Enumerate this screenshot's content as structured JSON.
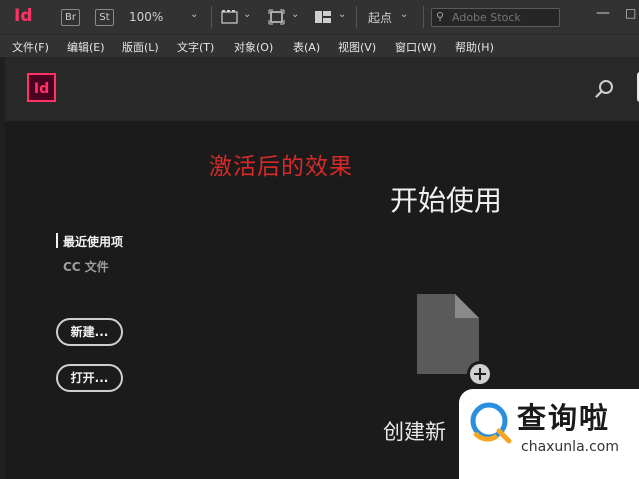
{
  "app": {
    "logo": "Id",
    "bridge_label": "Br",
    "stock_label": "St",
    "zoom": "100%",
    "workspace": "起点",
    "search_placeholder": "Adobe Stock"
  },
  "menu": [
    "文件(F)",
    "编辑(E)",
    "版面(L)",
    "文字(T)",
    "对象(O)",
    "表(A)",
    "视图(V)",
    "窗口(W)",
    "帮助(H)"
  ],
  "start": {
    "logo": "Id",
    "caption": "激活后的效果",
    "title": "开始使用",
    "nav": {
      "recent": "最近使用项",
      "cc_files": "CC 文件"
    },
    "new_button": "新建...",
    "open_button": "打开...",
    "create_new_label": "创建新"
  },
  "watermark": {
    "text": "查询啦",
    "url": "chaxunla.com"
  },
  "colors": {
    "indesign_pink": "#ff3366",
    "caption_red": "#d42a2a",
    "background": "#1b1b1b"
  }
}
